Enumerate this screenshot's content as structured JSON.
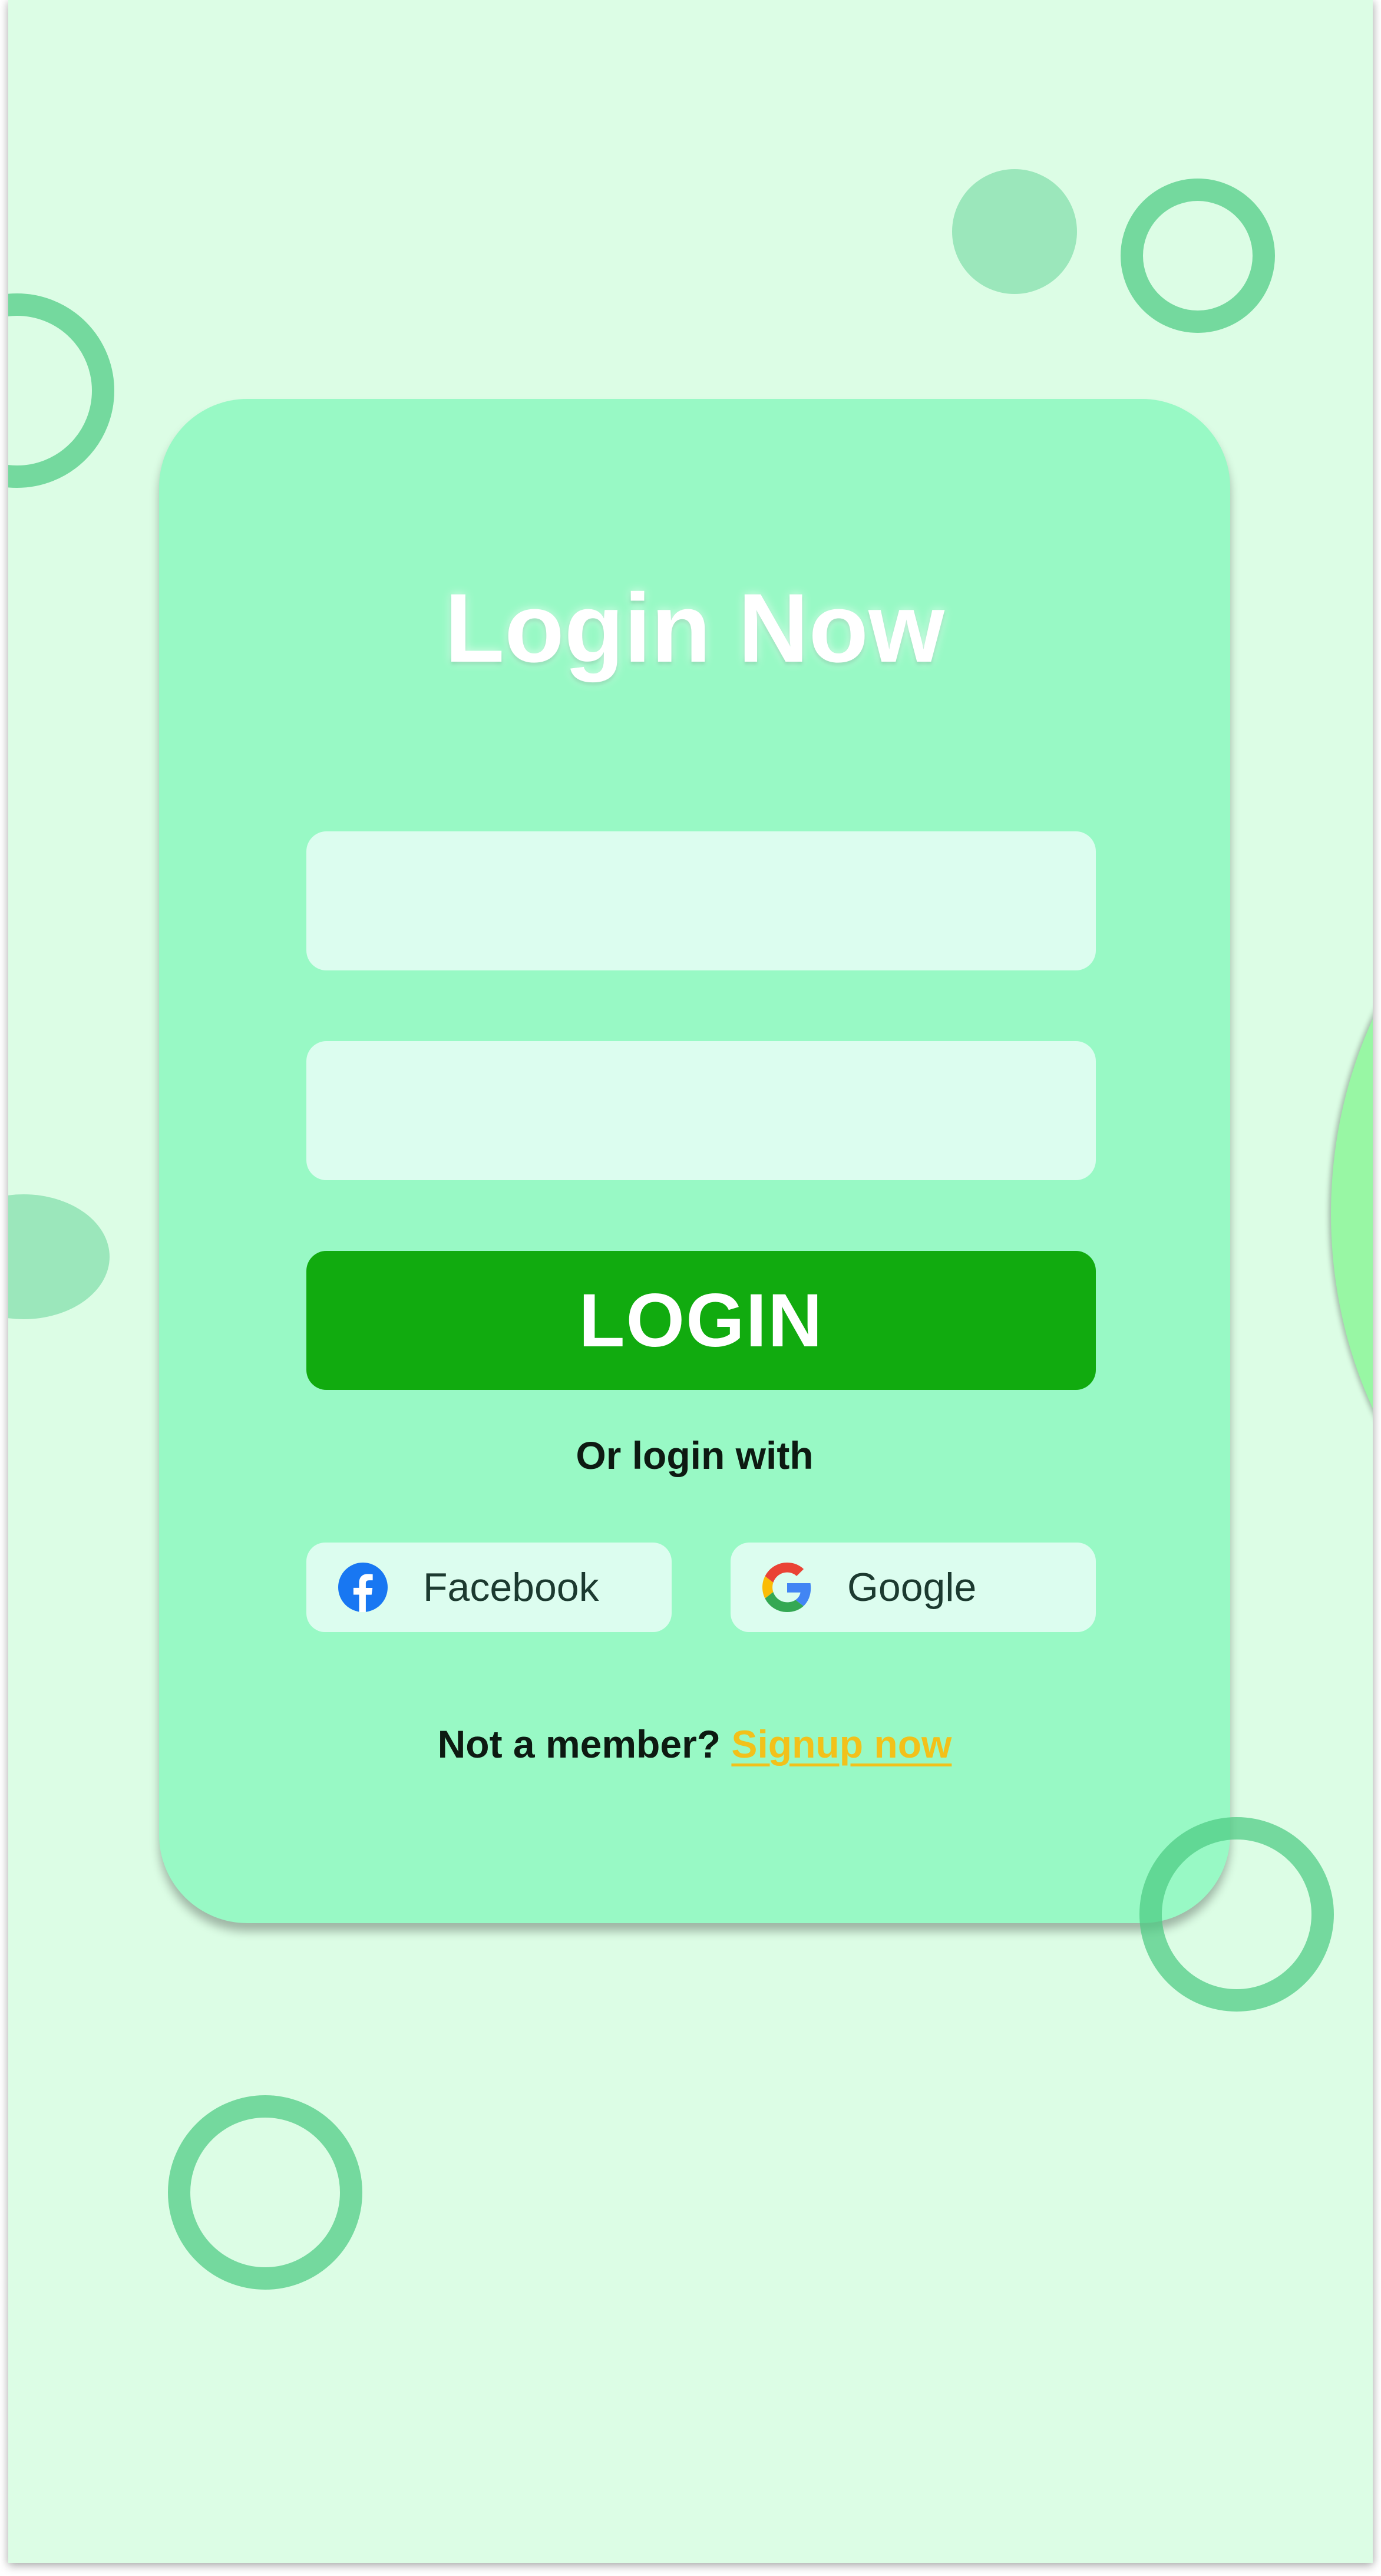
{
  "login_card": {
    "title": "Login Now",
    "username_field": {
      "value": "",
      "placeholder": ""
    },
    "password_field": {
      "value": "",
      "placeholder": ""
    },
    "login_button_label": "LOGIN",
    "alt_login_text": "Or login with",
    "social_buttons": [
      {
        "label": "Facebook",
        "icon": "facebook-icon"
      },
      {
        "label": "Google",
        "icon": "google-icon"
      }
    ],
    "footer_prompt": "Not a member?",
    "signup_link_label": "Signup now"
  },
  "colors": {
    "background": "#dcfde5",
    "card": "#98f9c5",
    "input_fill": "#dcfdef",
    "login_button": "#11ab0f",
    "signup_link": "#f2c11a",
    "decor_ring": "#4ccb82"
  }
}
